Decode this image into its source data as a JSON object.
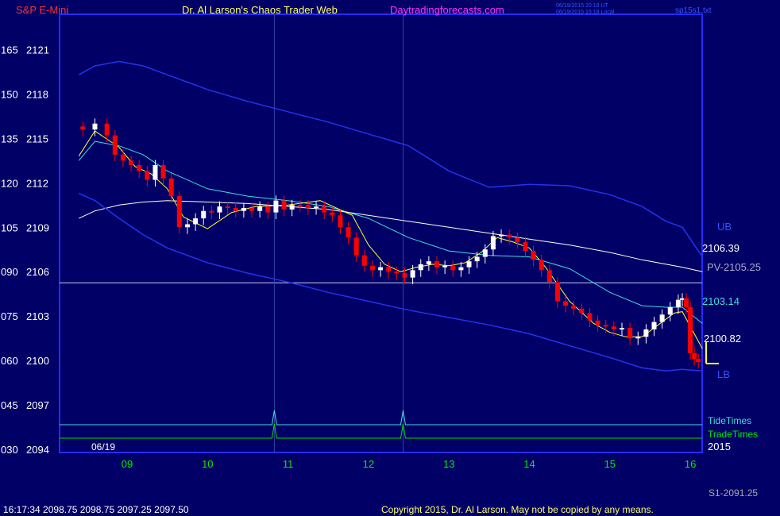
{
  "header": {
    "instrument": "S&P E-Mini",
    "site": "Dr. Al Larson's Chaos Trader Web",
    "url": "Daytradingforecasts.com",
    "time_utc": "06/19/2015 20:18 UT",
    "time_local": "06/19/2015 15:18 Local",
    "file": "sp15s1.txt"
  },
  "footer": {
    "quote": "16:17:34  2098.75 2098.75 2097.25 2097.50",
    "copyright": "Copyright 2015, Dr. Al Larson. May not be copied by any means.",
    "s1": "S1-2091.25"
  },
  "colors": {
    "background": "#000066",
    "frame": "#2a2aff",
    "band": "#2233ee",
    "ma_cyan": "#44dddd",
    "ma_yellow": "#ffff33",
    "ma_white": "#ffffee",
    "candle_down": "#ff0000",
    "candle_up": "#ffffff"
  },
  "chart_data": {
    "type": "line",
    "title": "S&P E-Mini",
    "xlabel": "",
    "ylabel": "",
    "x_ticks": [
      "09",
      "10",
      "11",
      "12",
      "13",
      "14",
      "15",
      "16"
    ],
    "date_label": "06/19",
    "year_label": "2015",
    "y_ticks_left": [
      "165",
      "150",
      "135",
      "120",
      "105",
      "090",
      "075",
      "060",
      "045",
      "030"
    ],
    "y_ticks_right": [
      "2121",
      "2118",
      "2115",
      "2112",
      "2109",
      "2106",
      "2103",
      "2100",
      "2097",
      "2094"
    ],
    "ylim": [
      2094,
      2121
    ],
    "xlim": [
      8.4,
      16.25
    ],
    "labels": {
      "ub": "UB",
      "lb": "LB",
      "v_upper": "2106.39",
      "pv": "PV-2105.25",
      "v_cyan": "2103.14",
      "v_yellow": "2100.82",
      "tide": "TideTimes",
      "trade": "TradeTimes"
    },
    "pv_level": 2105.25,
    "vertical_markers": [
      10.83,
      12.43
    ],
    "series": [
      {
        "name": "upper-band",
        "color": "#2233ee",
        "x": [
          8.4,
          8.6,
          8.9,
          9.2,
          9.5,
          10,
          10.5,
          11,
          11.5,
          12,
          12.5,
          13,
          13.5,
          14,
          14.5,
          15,
          15.4,
          15.7,
          15.9,
          16.15
        ],
        "y": [
          2119.3,
          2119.9,
          2120.2,
          2119.9,
          2119.3,
          2118.3,
          2117.5,
          2116.8,
          2116.1,
          2115.3,
          2114.5,
          2112.8,
          2111.7,
          2111.9,
          2111.8,
          2111.2,
          2110.4,
          2109.4,
          2109.0,
          2107.0
        ]
      },
      {
        "name": "cyan-ma",
        "color": "#44dddd",
        "x": [
          8.4,
          8.6,
          8.9,
          9.2,
          9.5,
          10,
          10.5,
          11,
          11.5,
          12,
          12.5,
          13,
          13.5,
          14,
          14.5,
          15,
          15.4,
          15.7,
          15.9,
          16.15
        ],
        "y": [
          2113.5,
          2114.8,
          2114.5,
          2113.9,
          2112.8,
          2111.6,
          2111.1,
          2110.8,
          2110.4,
          2109.6,
          2108.3,
          2107.4,
          2107.1,
          2107.0,
          2106.2,
          2104.6,
          2103.7,
          2103.6,
          2103.6,
          2102.5
        ]
      },
      {
        "name": "white-ma",
        "color": "#ffffee",
        "x": [
          8.4,
          8.6,
          8.9,
          9.2,
          9.5,
          10,
          10.5,
          11,
          11.5,
          12,
          12.5,
          13,
          13.5,
          14,
          14.5,
          15,
          15.4,
          15.7,
          15.9,
          16.15
        ],
        "y": [
          2109.6,
          2110.1,
          2110.5,
          2110.7,
          2110.8,
          2110.7,
          2110.6,
          2110.4,
          2110.2,
          2109.8,
          2109.4,
          2109.0,
          2108.6,
          2108.2,
          2107.8,
          2107.3,
          2106.8,
          2106.5,
          2106.3,
          2106.0
        ]
      },
      {
        "name": "lower-band",
        "color": "#2233ee",
        "x": [
          8.4,
          8.6,
          8.9,
          9.2,
          9.5,
          10,
          10.5,
          11,
          11.5,
          12,
          12.5,
          13,
          13.5,
          14,
          14.5,
          15,
          15.4,
          15.7,
          15.9,
          16.15
        ],
        "y": [
          2111.3,
          2110.8,
          2109.6,
          2108.5,
          2107.6,
          2106.6,
          2105.9,
          2105.3,
          2104.6,
          2104.0,
          2103.4,
          2102.9,
          2102.4,
          2101.8,
          2101.0,
          2100.2,
          2099.5,
          2099.3,
          2099.4,
          2099.3
        ]
      },
      {
        "name": "yellow-ma",
        "color": "#ffff33",
        "x": [
          8.4,
          8.6,
          8.9,
          9.1,
          9.3,
          9.5,
          9.7,
          10,
          10.3,
          10.6,
          11,
          11.4,
          11.8,
          12,
          12.2,
          12.4,
          12.6,
          12.8,
          13,
          13.2,
          13.4,
          13.6,
          13.8,
          14,
          14.2,
          14.5,
          14.8,
          15,
          15.2,
          15.4,
          15.6,
          15.8,
          15.9,
          16.15
        ],
        "y": [
          2113.8,
          2115.5,
          2114.4,
          2113.1,
          2112.6,
          2111.6,
          2109.7,
          2108.9,
          2110.0,
          2110.4,
          2110.5,
          2110.8,
          2109.8,
          2107.8,
          2106.5,
          2106.0,
          2106.3,
          2106.5,
          2106.4,
          2106.6,
          2107.3,
          2108.3,
          2108.0,
          2107.6,
          2106.3,
          2104.0,
          2102.5,
          2101.9,
          2101.6,
          2101.6,
          2102.4,
          2103.2,
          2103.3,
          2100.8
        ]
      },
      {
        "name": "close",
        "color": "#ff0000",
        "x": [
          8.45,
          8.6,
          8.75,
          8.85,
          8.95,
          9.05,
          9.15,
          9.25,
          9.35,
          9.45,
          9.55,
          9.65,
          9.75,
          9.85,
          9.95,
          10.05,
          10.15,
          10.25,
          10.35,
          10.45,
          10.55,
          10.65,
          10.75,
          10.85,
          10.95,
          11.05,
          11.15,
          11.25,
          11.35,
          11.45,
          11.55,
          11.65,
          11.75,
          11.85,
          11.95,
          12.05,
          12.15,
          12.25,
          12.35,
          12.45,
          12.55,
          12.65,
          12.75,
          12.85,
          12.95,
          13.05,
          13.15,
          13.25,
          13.35,
          13.45,
          13.55,
          13.65,
          13.75,
          13.85,
          13.95,
          14.05,
          14.15,
          14.25,
          14.35,
          14.45,
          14.55,
          14.65,
          14.75,
          14.85,
          14.95,
          15.05,
          15.15,
          15.25,
          15.35,
          15.45,
          15.55,
          15.65,
          15.75,
          15.85,
          15.9,
          15.95,
          16.0,
          16.05,
          16.1
        ],
        "y": [
          2115.6,
          2116.0,
          2115.2,
          2113.9,
          2113.5,
          2113.2,
          2112.8,
          2112.2,
          2113.2,
          2112.3,
          2111.1,
          2109.0,
          2109.2,
          2109.6,
          2110.1,
          2110.0,
          2110.4,
          2110.3,
          2110.1,
          2110.3,
          2110.1,
          2110.4,
          2110.0,
          2110.8,
          2110.2,
          2110.5,
          2110.5,
          2110.3,
          2110.4,
          2110.0,
          2109.8,
          2109.0,
          2108.3,
          2107.1,
          2106.4,
          2106.1,
          2106.3,
          2106.0,
          2105.9,
          2105.6,
          2106.1,
          2106.5,
          2106.7,
          2106.3,
          2106.4,
          2106.1,
          2106.3,
          2106.7,
          2107.0,
          2107.5,
          2108.4,
          2108.5,
          2108.3,
          2108.0,
          2107.4,
          2106.8,
          2106.1,
          2105.3,
          2104.0,
          2103.7,
          2103.5,
          2103.2,
          2102.7,
          2102.4,
          2102.3,
          2102.1,
          2102.2,
          2101.5,
          2101.6,
          2102.1,
          2102.6,
          2103.1,
          2103.6,
          2104.1,
          2104.2,
          2103.6,
          2100.5,
          2100.1,
          2099.9
        ]
      }
    ],
    "tide_peaks": [
      10.83,
      12.43
    ],
    "trade_peaks": [
      10.83,
      12.43
    ]
  }
}
